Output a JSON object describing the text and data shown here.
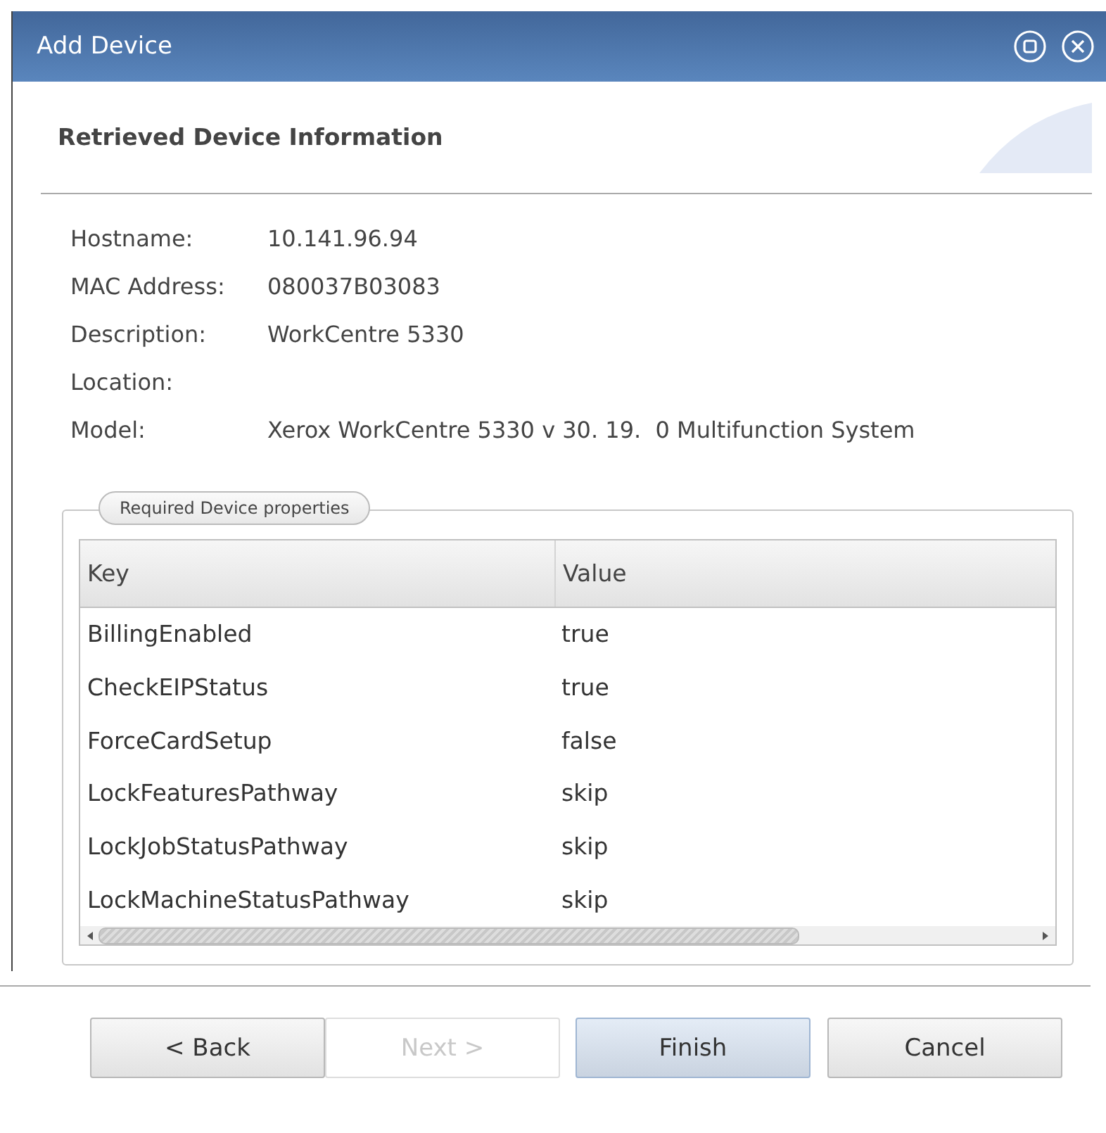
{
  "window": {
    "title": "Add Device"
  },
  "section_title": "Retrieved Device Information",
  "info": [
    {
      "label": "Hostname:",
      "value": "10.141.96.94"
    },
    {
      "label": "MAC Address:",
      "value": "080037B03083"
    },
    {
      "label": "Description:",
      "value": "WorkCentre 5330"
    },
    {
      "label": "Location:"
    },
    {
      "label": "Model:",
      "value": "Xerox WorkCentre 5330 v 30. 19.  0 Multifunction System"
    }
  ],
  "properties": {
    "legend": "Required Device properties",
    "columns": [
      "Key",
      "Value"
    ],
    "rows": [
      [
        "BillingEnabled",
        "true"
      ],
      [
        "CheckEIPStatus",
        "true"
      ],
      [
        "ForceCardSetup",
        "false"
      ],
      [
        "LockFeaturesPathway",
        "skip"
      ],
      [
        "LockJobStatusPathway",
        "skip"
      ],
      [
        "LockMachineStatusPathway",
        "skip"
      ]
    ]
  },
  "buttons": [
    {
      "label": "< Back",
      "disabled": false,
      "default": false
    },
    {
      "label": "Next >",
      "disabled": true,
      "default": false
    },
    {
      "label": "Finish",
      "disabled": false,
      "default": true
    },
    {
      "label": "Cancel",
      "disabled": false,
      "default": false
    }
  ]
}
